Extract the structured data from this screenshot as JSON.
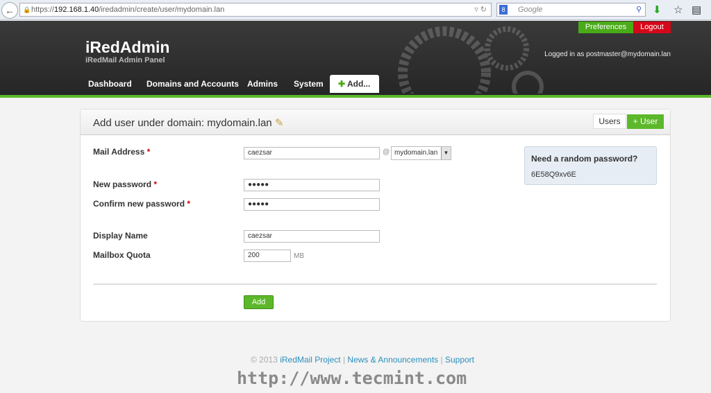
{
  "browser": {
    "back": "←",
    "url_prefix": "https://",
    "url_host": "192.168.1.40",
    "url_path": "/iredadmin/create/user/mydomain.lan",
    "search_placeholder": "Google"
  },
  "header": {
    "title": "iRedAdmin",
    "subtitle": "iRedMail Admin Panel",
    "preferences": "Preferences",
    "logout": "Logout",
    "logged_in": "Logged in as postmaster@mydomain.lan",
    "nav": [
      "Dashboard",
      "Domains and Accounts",
      "Admins",
      "System"
    ],
    "add": "Add..."
  },
  "panel": {
    "title": "Add user under domain: mydomain.lan",
    "tab_users": "Users",
    "tab_user": "User",
    "fields": {
      "mail_label": "Mail Address",
      "mail_value": "caezsar",
      "at": "@",
      "domain": "mydomain.lan",
      "pw_label": "New password",
      "pw_value": "●●●●●",
      "cpw_label": "Confirm new password",
      "cpw_value": "●●●●●",
      "display_label": "Display Name",
      "display_value": "caezsar",
      "quota_label": "Mailbox Quota",
      "quota_value": "200",
      "quota_unit": "MB",
      "required": "*"
    },
    "random": {
      "title": "Need a random password?",
      "password": "6E58Q9xv6E"
    },
    "add_button": "Add"
  },
  "footer": {
    "copyright": "© 2013",
    "project": "iRedMail Project",
    "news": "News & Announcements",
    "support": "Support",
    "sep": "|"
  },
  "watermark": "http://www.tecmint.com",
  "colors": {
    "green": "#5cb82a",
    "red": "#d4081a",
    "link": "#2a8fbd"
  }
}
